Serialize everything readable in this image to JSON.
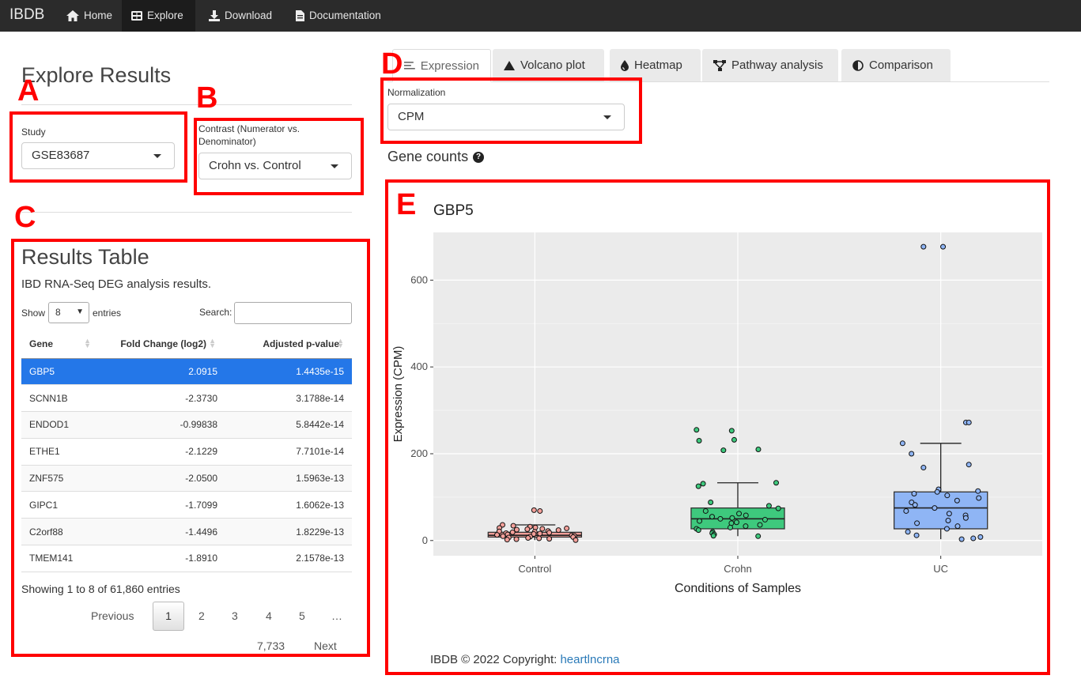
{
  "navbar": {
    "brand": "IBDB",
    "items": [
      {
        "label": "Home",
        "icon": "home-icon"
      },
      {
        "label": "Explore",
        "icon": "table-icon"
      },
      {
        "label": "Download",
        "icon": "download-icon"
      },
      {
        "label": "Documentation",
        "icon": "file-icon"
      }
    ]
  },
  "page": {
    "title": "Explore Results"
  },
  "study": {
    "label": "Study",
    "value": "GSE83687"
  },
  "contrast": {
    "label": "Contrast (Numerator vs. Denominator)",
    "label_line1": "Contrast (Numerator vs.",
    "label_line2": "Denominator)",
    "value": "Crohn vs. Control"
  },
  "annotations": {
    "a": "A",
    "b": "B",
    "c": "C",
    "d": "D",
    "e": "E"
  },
  "results": {
    "title": "Results Table",
    "subtitle": "IBD RNA-Seq DEG analysis results.",
    "show_label": "Show",
    "entries_value": "8",
    "entries_label": "entries",
    "search_label": "Search:",
    "columns": [
      "Gene",
      "Fold Change (log2)",
      "Adjusted p-value"
    ],
    "rows": [
      {
        "gene": "GBP5",
        "fc": "2.0915",
        "p": "1.4435e-15"
      },
      {
        "gene": "SCNN1B",
        "fc": "-2.3730",
        "p": "3.1788e-14"
      },
      {
        "gene": "ENDOD1",
        "fc": "-0.99838",
        "p": "5.8442e-14"
      },
      {
        "gene": "ETHE1",
        "fc": "-2.1229",
        "p": "7.7101e-14"
      },
      {
        "gene": "ZNF575",
        "fc": "-2.0500",
        "p": "1.5963e-13"
      },
      {
        "gene": "GIPC1",
        "fc": "-1.7099",
        "p": "1.6062e-13"
      },
      {
        "gene": "C2orf88",
        "fc": "-1.4496",
        "p": "1.8229e-13"
      },
      {
        "gene": "TMEM141",
        "fc": "-1.8910",
        "p": "2.1578e-13"
      }
    ],
    "info": "Showing 1 to 8 of 61,860 entries",
    "pagination": {
      "previous": "Previous",
      "pages": [
        "1",
        "2",
        "3",
        "4",
        "5"
      ],
      "ellipsis": "…",
      "last": "7,733",
      "next": "Next"
    }
  },
  "tabs": [
    {
      "label": "Expression",
      "icon": "list-icon"
    },
    {
      "label": "Volcano plot",
      "icon": "triangle-icon"
    },
    {
      "label": "Heatmap",
      "icon": "drop-icon"
    },
    {
      "label": "Pathway analysis",
      "icon": "network-icon"
    },
    {
      "label": "Comparison",
      "icon": "half-circle-icon"
    }
  ],
  "normalization": {
    "label": "Normalization",
    "value": "CPM"
  },
  "gene_counts": {
    "label": "Gene counts",
    "help": "?"
  },
  "chart_data": {
    "type": "boxplot",
    "title": "GBP5",
    "xlabel": "Conditions of Samples",
    "ylabel": "Expression (CPM)",
    "categories": [
      "Control",
      "Crohn",
      "UC"
    ],
    "ylim": [
      -35,
      710
    ],
    "yticks": [
      0,
      200,
      400,
      600
    ],
    "colors": {
      "Control": "#f4a09a",
      "Crohn": "#3ec97d",
      "UC": "#8fb5f5",
      "panel": "#ebebeb"
    },
    "boxes": [
      {
        "category": "Control",
        "q1": 8,
        "median": 12,
        "q3": 19,
        "whisker_low": 1,
        "whisker_high": 36
      },
      {
        "category": "Crohn",
        "q1": 27,
        "median": 50,
        "q3": 75,
        "whisker_low": 10,
        "whisker_high": 133
      },
      {
        "category": "UC",
        "q1": 27,
        "median": 75,
        "q3": 112,
        "whisker_low": 3,
        "whisker_high": 224
      }
    ],
    "points": {
      "Control": [
        70,
        68,
        36,
        34,
        32,
        30,
        29,
        28,
        27,
        26,
        25,
        24,
        22,
        21,
        20,
        19,
        18,
        17,
        16,
        15,
        14,
        13,
        12,
        11,
        10,
        9,
        8,
        7,
        6,
        5,
        4,
        3,
        2,
        1
      ],
      "Crohn": [
        255,
        253,
        232,
        230,
        210,
        208,
        133,
        131,
        125,
        88,
        80,
        74,
        68,
        62,
        58,
        55,
        52,
        50,
        48,
        45,
        42,
        40,
        36,
        33,
        30,
        27,
        24,
        20,
        17,
        14,
        11,
        10
      ],
      "UC": [
        677,
        677,
        272,
        272,
        224,
        200,
        175,
        168,
        118,
        114,
        112,
        108,
        104,
        98,
        92,
        88,
        82,
        75,
        68,
        62,
        58,
        52,
        46,
        40,
        33,
        27,
        20,
        12,
        8,
        5,
        3
      ]
    }
  },
  "footer": {
    "text": "IBDB © 2022 Copyright: ",
    "link": "heartlncrna"
  }
}
